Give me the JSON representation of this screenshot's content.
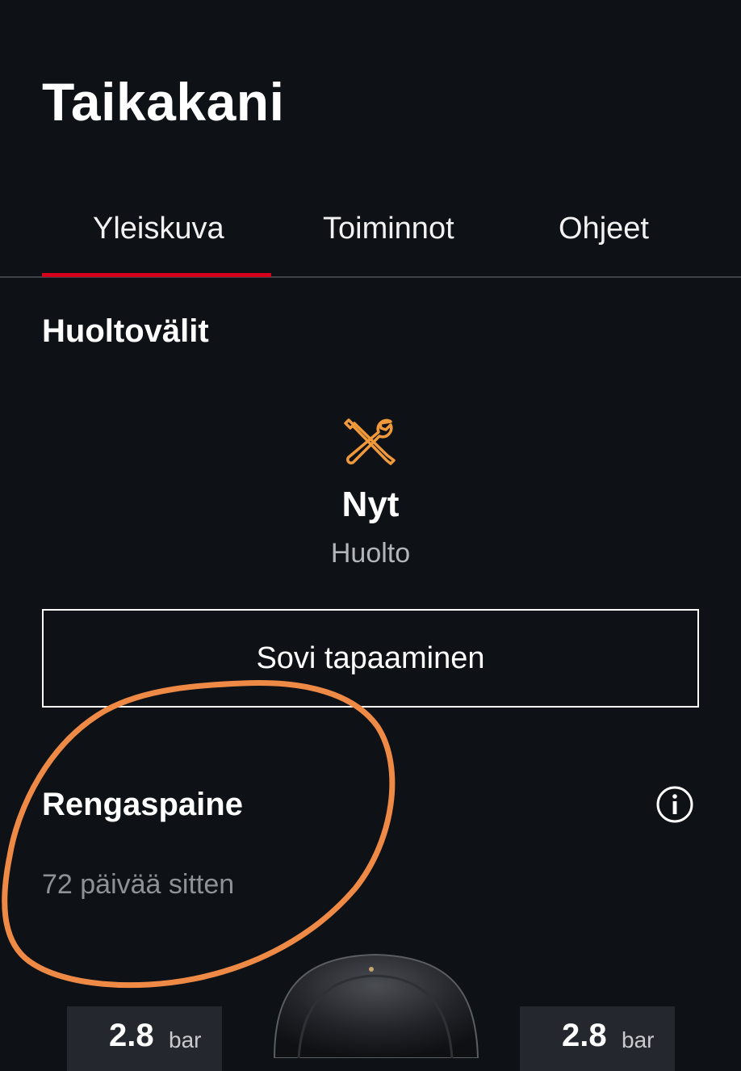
{
  "header": {
    "title": "Taikakani"
  },
  "tabs": [
    {
      "label": "Yleiskuva",
      "active": true
    },
    {
      "label": "Toiminnot",
      "active": false
    },
    {
      "label": "Ohjeet",
      "active": false
    }
  ],
  "service": {
    "section_title": "Huoltovälit",
    "icon": "wrench-screwdriver-icon",
    "status": "Nyt",
    "label": "Huolto",
    "appointment_button": "Sovi tapaaminen"
  },
  "tire_pressure": {
    "section_title": "Rengaspaine",
    "info_icon": "info-icon",
    "last_updated": "72 päivää sitten",
    "front_left": {
      "value": "2.8",
      "unit": "bar"
    },
    "front_right": {
      "value": "2.8",
      "unit": "bar"
    }
  },
  "colors": {
    "background": "#0e1116",
    "accent_red": "#d5001c",
    "service_orange": "#f0993b",
    "annotation_orange": "#ee8a45"
  }
}
